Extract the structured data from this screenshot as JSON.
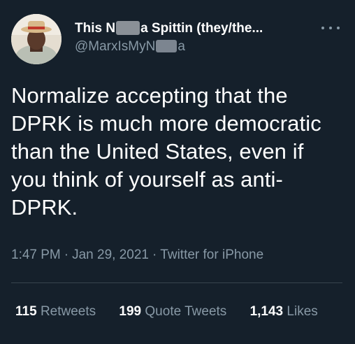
{
  "author": {
    "name_prefix": "This N",
    "name_suffix": "a Spittin (they/the...",
    "handle_prefix": "@MarxIsMyN",
    "handle_suffix": "a",
    "avatar_icon": "profile-photo"
  },
  "tweet": {
    "text": "Normalize accepting that the DPRK is much more democratic than the United States, even if you think of yourself as anti-DPRK."
  },
  "meta": {
    "time": "1:47 PM",
    "separator": "·",
    "date": "Jan 29, 2021",
    "source": "Twitter for iPhone"
  },
  "stats": {
    "retweets_count": "115",
    "retweets_label": "Retweets",
    "quotes_count": "199",
    "quotes_label": "Quote Tweets",
    "likes_count": "1,143",
    "likes_label": "Likes"
  },
  "colors": {
    "background": "#15202b",
    "primary_text": "#ffffff",
    "secondary_text": "#8899a6",
    "divider": "#38444d"
  }
}
